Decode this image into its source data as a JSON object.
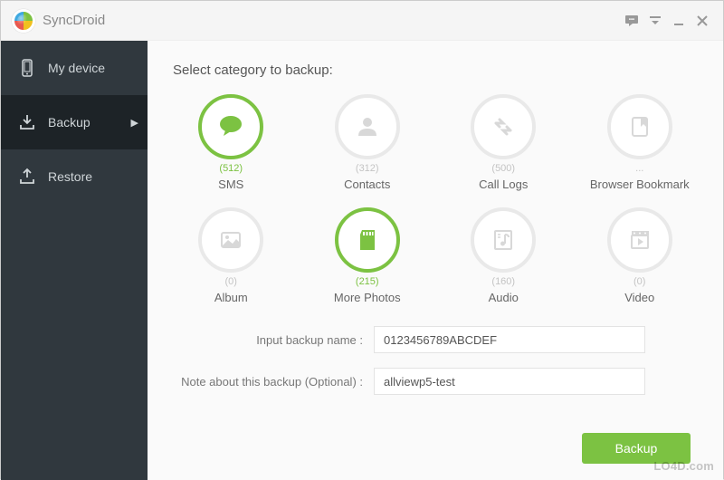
{
  "app": {
    "title": "SyncDroid"
  },
  "titlebar_controls": {
    "feedback": "feedback",
    "menu": "menu",
    "minimize": "minimize",
    "close": "close"
  },
  "sidebar": {
    "items": [
      {
        "id": "my-device",
        "label": "My device",
        "active": false
      },
      {
        "id": "backup",
        "label": "Backup",
        "active": true
      },
      {
        "id": "restore",
        "label": "Restore",
        "active": false
      }
    ]
  },
  "main": {
    "heading": "Select category to backup:",
    "categories": [
      {
        "id": "sms",
        "label": "SMS",
        "count": "(512)",
        "selected": true
      },
      {
        "id": "contacts",
        "label": "Contacts",
        "count": "(312)",
        "selected": false
      },
      {
        "id": "calllogs",
        "label": "Call Logs",
        "count": "(500)",
        "selected": false
      },
      {
        "id": "bookmarks",
        "label": "Browser Bookmark",
        "count": "...",
        "selected": false
      },
      {
        "id": "album",
        "label": "Album",
        "count": "(0)",
        "selected": false
      },
      {
        "id": "morephotos",
        "label": "More Photos",
        "count": "(215)",
        "selected": true
      },
      {
        "id": "audio",
        "label": "Audio",
        "count": "(160)",
        "selected": false
      },
      {
        "id": "video",
        "label": "Video",
        "count": "(0)",
        "selected": false
      }
    ],
    "form": {
      "name_label": "Input backup name :",
      "name_value": "0123456789ABCDEF",
      "note_label": "Note about this backup (Optional) :",
      "note_value": "allviewp5-test"
    },
    "backup_button": "Backup"
  },
  "colors": {
    "accent": "#7cc242",
    "sidebar": "#30383e",
    "sidebar_active": "#1d2327"
  },
  "watermark": "LO4D.com"
}
